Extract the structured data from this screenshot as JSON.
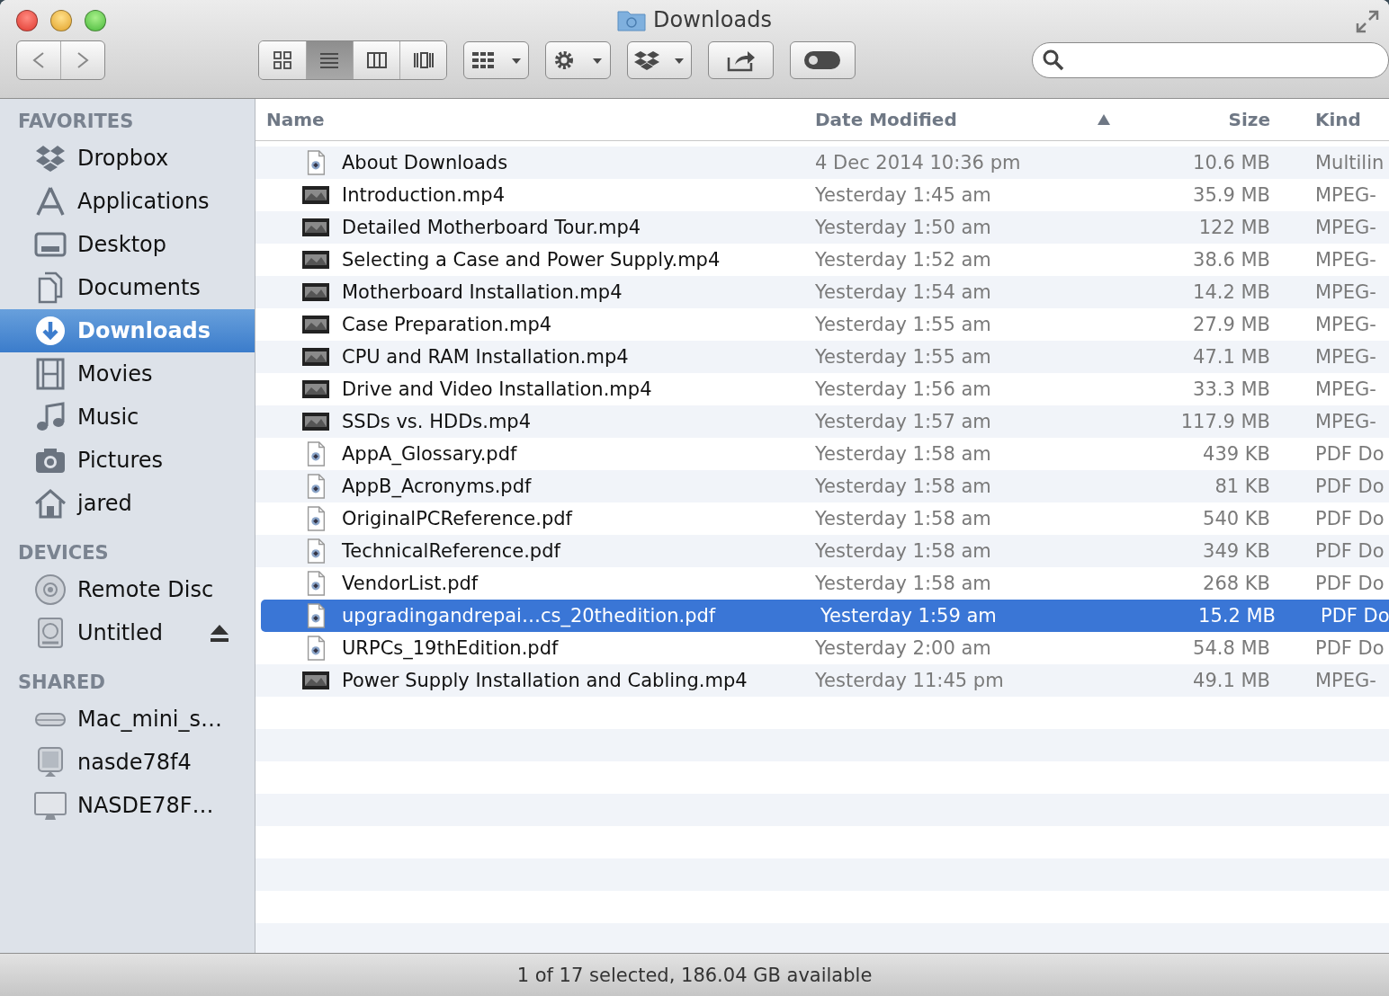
{
  "window": {
    "title": "Downloads"
  },
  "toolbar": {
    "view_modes": [
      {
        "kind": "icons",
        "selected": false
      },
      {
        "kind": "list",
        "selected": true
      },
      {
        "kind": "columns",
        "selected": false
      },
      {
        "kind": "coverflow",
        "selected": false
      }
    ],
    "buttons": [
      {
        "kind": "arrange"
      },
      {
        "kind": "action"
      },
      {
        "kind": "dropbox"
      },
      {
        "kind": "share"
      },
      {
        "kind": "toggle"
      }
    ]
  },
  "sidebar": {
    "sections": [
      {
        "title": "FAVORITES",
        "items": [
          {
            "label": "Dropbox",
            "kind": "dropbox",
            "selected": false,
            "ejectable": false
          },
          {
            "label": "Applications",
            "kind": "applications",
            "selected": false,
            "ejectable": false
          },
          {
            "label": "Desktop",
            "kind": "desktop",
            "selected": false,
            "ejectable": false
          },
          {
            "label": "Documents",
            "kind": "documents",
            "selected": false,
            "ejectable": false
          },
          {
            "label": "Downloads",
            "kind": "downloads",
            "selected": true,
            "ejectable": false
          },
          {
            "label": "Movies",
            "kind": "movies",
            "selected": false,
            "ejectable": false
          },
          {
            "label": "Music",
            "kind": "music",
            "selected": false,
            "ejectable": false
          },
          {
            "label": "Pictures",
            "kind": "pictures",
            "selected": false,
            "ejectable": false
          },
          {
            "label": "jared",
            "kind": "home",
            "selected": false,
            "ejectable": false
          }
        ]
      },
      {
        "title": "DEVICES",
        "items": [
          {
            "label": "Remote Disc",
            "kind": "disc",
            "selected": false,
            "ejectable": false
          },
          {
            "label": "Untitled",
            "kind": "drive",
            "selected": false,
            "ejectable": true
          }
        ]
      },
      {
        "title": "SHARED",
        "items": [
          {
            "label": "Mac_mini_s…",
            "kind": "macmini",
            "selected": false,
            "ejectable": false
          },
          {
            "label": "nasde78f4",
            "kind": "server",
            "selected": false,
            "ejectable": false
          },
          {
            "label": "NASDE78F…",
            "kind": "display",
            "selected": false,
            "ejectable": false
          }
        ]
      }
    ]
  },
  "columns": [
    {
      "label": "Name",
      "sorted": false
    },
    {
      "label": "Date Modified",
      "sorted": true
    },
    {
      "label": "Size",
      "sorted": false
    },
    {
      "label": "Kind",
      "sorted": false
    }
  ],
  "files": [
    {
      "name": "About Downloads",
      "date": "4 Dec 2014 10:36 pm",
      "size": "10.6 MB",
      "file_type": "Multilin",
      "kind": "document",
      "selected": false
    },
    {
      "name": "Introduction.mp4",
      "date": "Yesterday 1:45 am",
      "size": "35.9 MB",
      "file_type": "MPEG-",
      "kind": "video",
      "selected": false
    },
    {
      "name": "Detailed Motherboard Tour.mp4",
      "date": "Yesterday 1:50 am",
      "size": "122 MB",
      "file_type": "MPEG-",
      "kind": "video",
      "selected": false
    },
    {
      "name": "Selecting a Case and Power Supply.mp4",
      "date": "Yesterday 1:52 am",
      "size": "38.6 MB",
      "file_type": "MPEG-",
      "kind": "video",
      "selected": false
    },
    {
      "name": "Motherboard Installation.mp4",
      "date": "Yesterday 1:54 am",
      "size": "14.2 MB",
      "file_type": "MPEG-",
      "kind": "video",
      "selected": false
    },
    {
      "name": "Case Preparation.mp4",
      "date": "Yesterday 1:55 am",
      "size": "27.9 MB",
      "file_type": "MPEG-",
      "kind": "video",
      "selected": false
    },
    {
      "name": "CPU and RAM Installation.mp4",
      "date": "Yesterday 1:55 am",
      "size": "47.1 MB",
      "file_type": "MPEG-",
      "kind": "video",
      "selected": false
    },
    {
      "name": "Drive and Video Installation.mp4",
      "date": "Yesterday 1:56 am",
      "size": "33.3 MB",
      "file_type": "MPEG-",
      "kind": "video",
      "selected": false
    },
    {
      "name": "SSDs vs. HDDs.mp4",
      "date": "Yesterday 1:57 am",
      "size": "117.9 MB",
      "file_type": "MPEG-",
      "kind": "video",
      "selected": false
    },
    {
      "name": "AppA_Glossary.pdf",
      "date": "Yesterday 1:58 am",
      "size": "439 KB",
      "file_type": "PDF Do",
      "kind": "document",
      "selected": false
    },
    {
      "name": "AppB_Acronyms.pdf",
      "date": "Yesterday 1:58 am",
      "size": "81 KB",
      "file_type": "PDF Do",
      "kind": "document",
      "selected": false
    },
    {
      "name": "OriginalPCReference.pdf",
      "date": "Yesterday 1:58 am",
      "size": "540 KB",
      "file_type": "PDF Do",
      "kind": "document",
      "selected": false
    },
    {
      "name": "TechnicalReference.pdf",
      "date": "Yesterday 1:58 am",
      "size": "349 KB",
      "file_type": "PDF Do",
      "kind": "document",
      "selected": false
    },
    {
      "name": "VendorList.pdf",
      "date": "Yesterday 1:58 am",
      "size": "268 KB",
      "file_type": "PDF Do",
      "kind": "document",
      "selected": false
    },
    {
      "name": "upgradingandrepai…cs_20thedition.pdf",
      "date": "Yesterday 1:59 am",
      "size": "15.2 MB",
      "file_type": "PDF Do",
      "kind": "document",
      "selected": true
    },
    {
      "name": "URPCs_19thEdition.pdf",
      "date": "Yesterday 2:00 am",
      "size": "54.8 MB",
      "file_type": "PDF Do",
      "kind": "document",
      "selected": false
    },
    {
      "name": "Power Supply Installation and Cabling.mp4",
      "date": "Yesterday 11:45 pm",
      "size": "49.1 MB",
      "file_type": "MPEG-",
      "kind": "video",
      "selected": false
    }
  ],
  "status_bar": "1 of 17 selected, 186.04 GB available"
}
